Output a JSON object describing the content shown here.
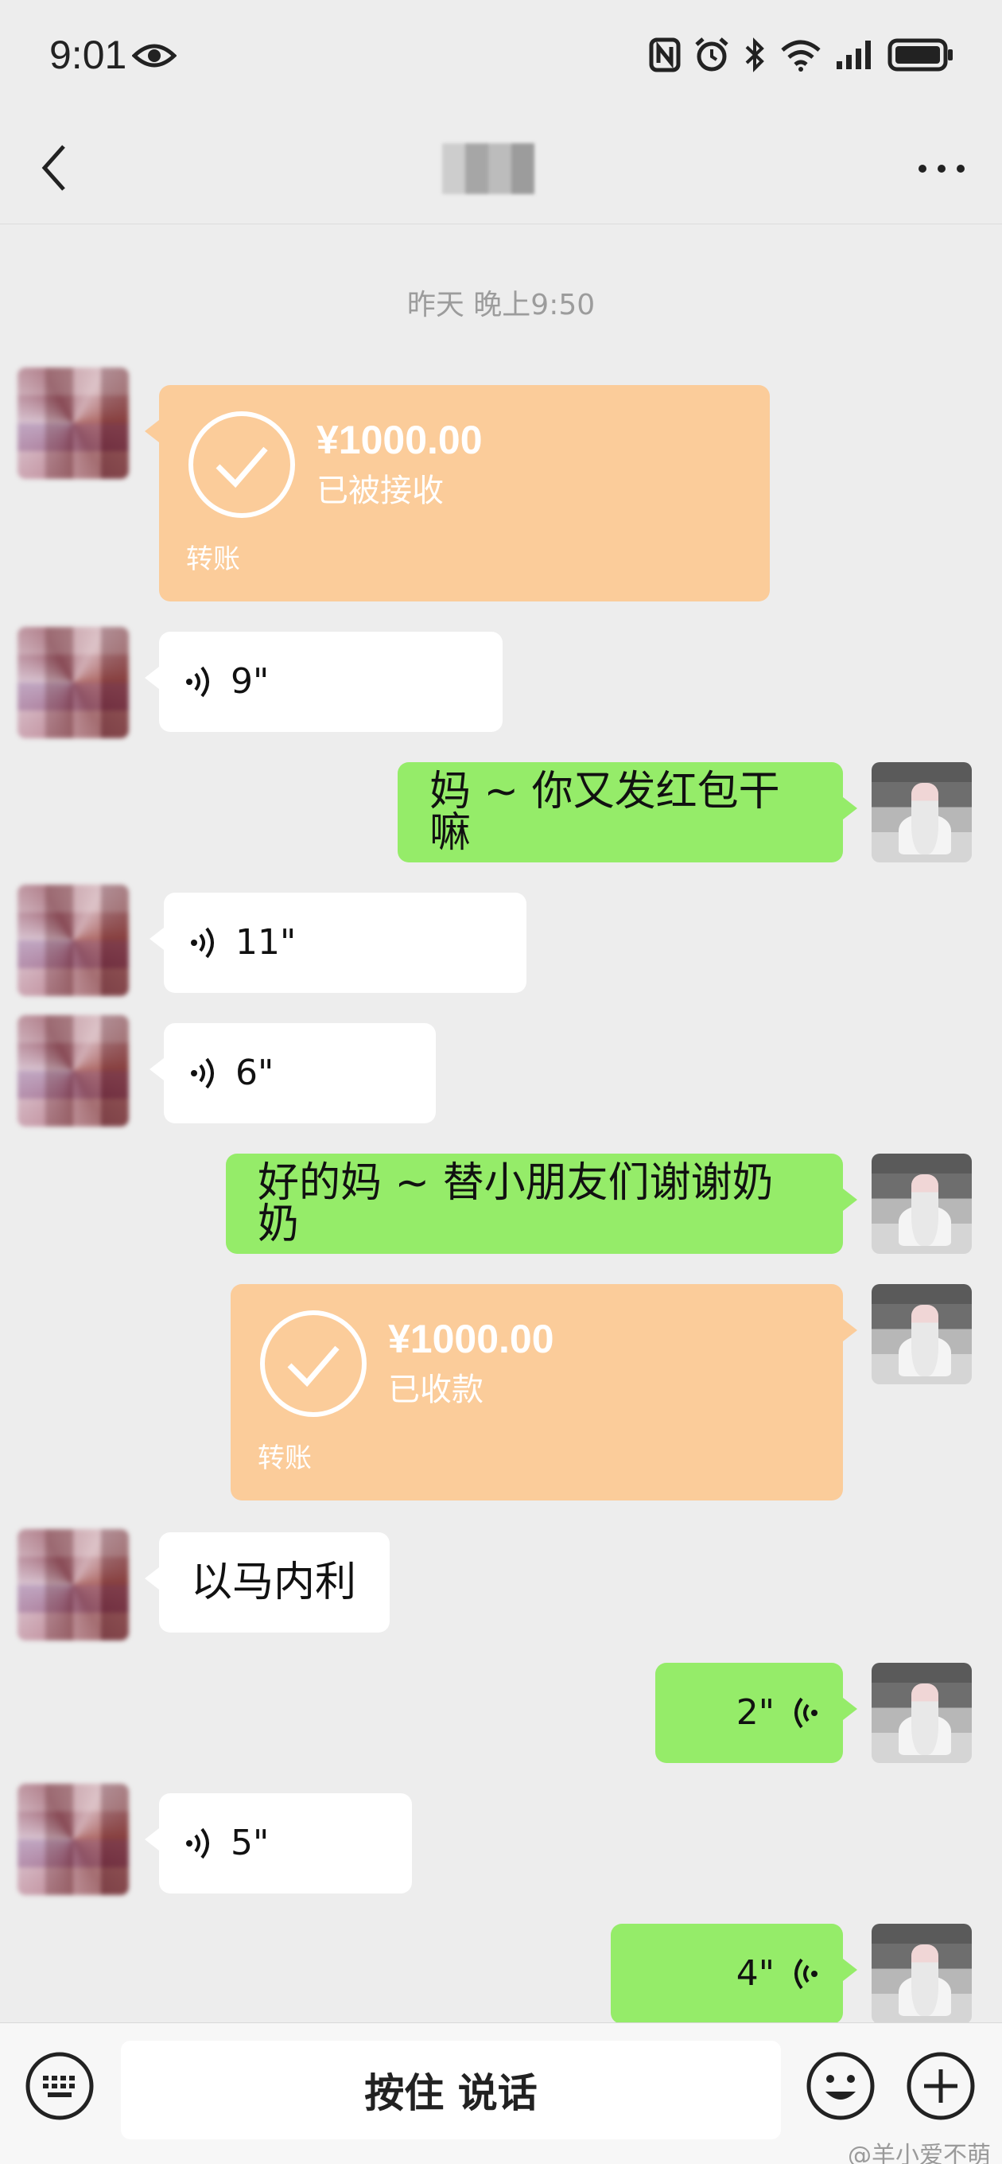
{
  "status_bar": {
    "time": "9:01",
    "icons": [
      "eye-icon",
      "nfc-icon",
      "alarm-icon",
      "bluetooth-icon",
      "wifi-6-icon",
      "signal-icon",
      "battery-icon"
    ]
  },
  "nav": {
    "back_icon": "chevron-left-icon",
    "more_icon": "more-dots-icon"
  },
  "chat": {
    "timestamp": "昨天 晚上9:50",
    "messages": [
      {
        "side": "left",
        "type": "transfer",
        "amount": "¥1000.00",
        "status": "已被接收",
        "label": "转账"
      },
      {
        "side": "left",
        "type": "voice",
        "duration": "9\""
      },
      {
        "side": "right",
        "type": "text",
        "text": "妈 ~ 你又发红包干嘛"
      },
      {
        "side": "left",
        "type": "voice",
        "duration": "11\""
      },
      {
        "side": "left",
        "type": "voice",
        "duration": "6\""
      },
      {
        "side": "right",
        "type": "text",
        "text": "好的妈 ~ 替小朋友们谢谢奶奶"
      },
      {
        "side": "right",
        "type": "transfer",
        "amount": "¥1000.00",
        "status": "已收款",
        "label": "转账"
      },
      {
        "side": "left",
        "type": "text",
        "text": "以马内利"
      },
      {
        "side": "right",
        "type": "voice",
        "duration": "2\""
      },
      {
        "side": "left",
        "type": "voice",
        "duration": "5\""
      },
      {
        "side": "right",
        "type": "voice",
        "duration": "4\""
      }
    ]
  },
  "input_bar": {
    "hold_to_talk": "按住 说话",
    "keyboard_icon": "keyboard-icon",
    "emoji_icon": "emoji-icon",
    "plus_icon": "plus-circle-icon"
  },
  "watermark": "@羊小爱不萌",
  "colors": {
    "background": "#ededed",
    "green_bubble": "#95ec69",
    "transfer_bubble": "#fbcc9a",
    "white_bubble": "#ffffff"
  }
}
